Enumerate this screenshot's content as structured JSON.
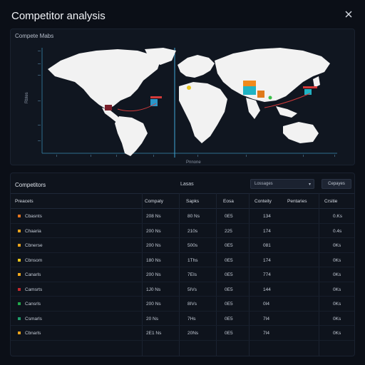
{
  "app": {
    "title": "Competitor analysis"
  },
  "map": {
    "title": "Compete Mabs",
    "x_label": "Pnnone",
    "y_label": "Rbtes",
    "colors": {
      "land": "#f2f2f2",
      "ocean": "#101620",
      "axis": "#3fa7d6",
      "flow": "#d23a3a"
    }
  },
  "table": {
    "title": "Competitors",
    "section_label": "Lasas",
    "filter": {
      "selected": "Lossages"
    },
    "export_label": "Cepayes",
    "columns": [
      "Preacets",
      "Compaty",
      "Sapks",
      "Eosa",
      "Conteity",
      "Pentaries",
      "Crsitie"
    ],
    "rows": [
      {
        "color": "#e3741f",
        "name": "Cbasnts",
        "c1": "208 Ns",
        "c2": "80 Ns",
        "c3": "0E5",
        "c4": "134",
        "c5": "0.Ks"
      },
      {
        "color": "#e8a21c",
        "name": "Chaaria",
        "c1": "200 Ns",
        "c2": "210s",
        "c3": "225",
        "c4": "174",
        "c5": "0.4s"
      },
      {
        "color": "#e8a21c",
        "name": "Cbnerse",
        "c1": "200 Ns",
        "c2": "500s",
        "c3": "0E5",
        "c4": "081",
        "c5": "0Ks"
      },
      {
        "color": "#e8c41c",
        "name": "Cbnsom",
        "c1": "180 Ns",
        "c2": "1Ths",
        "c3": "0E5",
        "c4": "174",
        "c5": "0Ks"
      },
      {
        "color": "#f0a81c",
        "name": "Canarls",
        "c1": "200 Ns",
        "c2": "7EIs",
        "c3": "0E5",
        "c4": "774",
        "c5": "0Ks"
      },
      {
        "color": "#c0282d",
        "name": "Camsrts",
        "c1": "1J0 Ns",
        "c2": "5IVs",
        "c3": "0E5",
        "c4": "144",
        "c5": "0Ks"
      },
      {
        "color": "#22a84a",
        "name": "Cansrls",
        "c1": "200 Ns",
        "c2": "8IVs",
        "c3": "0E5",
        "c4": "0I4",
        "c5": "0Ks"
      },
      {
        "color": "#1f9c6a",
        "name": "Csmarls",
        "c1": "20 Ns",
        "c2": "7Hs",
        "c3": "0E5",
        "c4": "7I4",
        "c5": "0Ks"
      },
      {
        "color": "#e8a21c",
        "name": "Cbnarls",
        "c1": "2E1 Ns",
        "c2": "20Ns",
        "c3": "0E5",
        "c4": "7I4",
        "c5": "0Ks"
      }
    ]
  }
}
